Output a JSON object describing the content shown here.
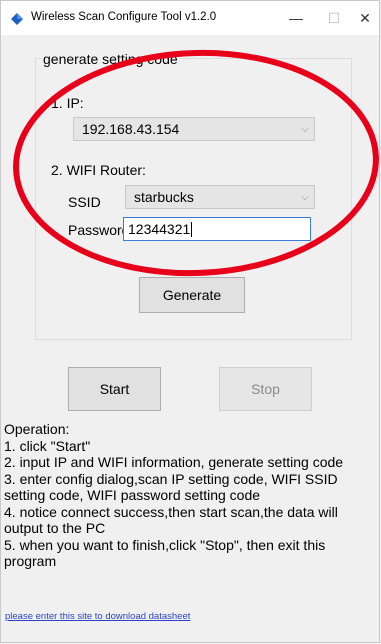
{
  "window": {
    "title": "Wireless Scan Configure Tool  v1.2.0",
    "minimize_glyph": "—",
    "maximize_glyph": "☐",
    "close_glyph": "✕"
  },
  "group": {
    "legend": "generate setting code",
    "ip_label": "1. IP:",
    "ip_value": "192.168.43.154",
    "wifi_label": "2. WIFI Router:",
    "ssid_label": "SSID",
    "ssid_value": "starbucks",
    "password_label": "Password",
    "password_value": "12344321",
    "generate_label": "Generate"
  },
  "controls": {
    "start_label": "Start",
    "stop_label": "Stop"
  },
  "operation": {
    "lines": [
      "Operation:",
      "1. click \"Start\"",
      "2. input IP and WIFI information, generate setting code",
      "3. enter config dialog,scan IP setting code, WIFI SSID setting code, WIFI password setting code",
      "4. notice connect success,then start scan,the data will output to the PC",
      "5. when you want to finish,click \"Stop\", then exit this program"
    ]
  },
  "footer": {
    "link_text": "please enter this site to download datasheet"
  },
  "colors": {
    "annotation_red": "#e8001a",
    "accent_blue": "#3b7ddd",
    "link_blue": "#2b44c8"
  },
  "icons": {
    "app": "app-diamond-icon",
    "dropdown": "chevron-down-icon"
  }
}
